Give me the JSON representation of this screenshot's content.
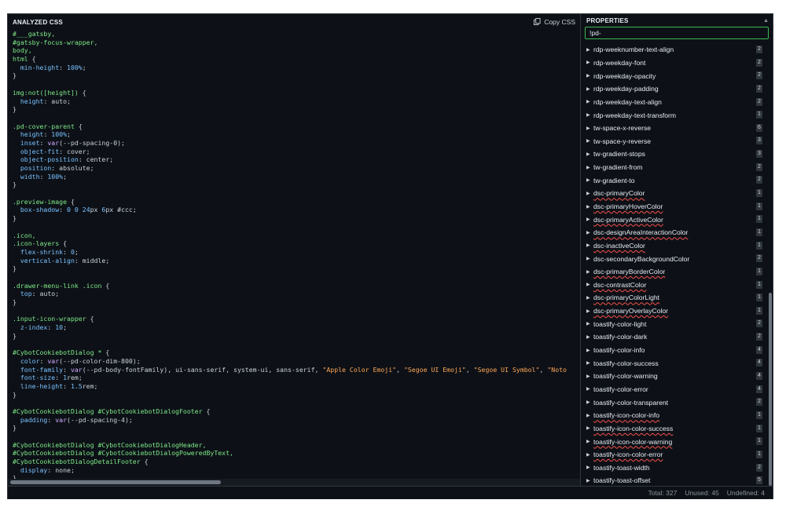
{
  "left_pane": {
    "title": "ANALYZED CSS",
    "copy_label": "Copy CSS",
    "code_lines": [
      [
        [
          "sel",
          "#___gatsby,"
        ]
      ],
      [
        [
          "sel",
          "#gatsby-focus-wrapper,"
        ]
      ],
      [
        [
          "sel",
          "body,"
        ]
      ],
      [
        [
          "sel",
          "html "
        ],
        [
          "punc",
          "{"
        ]
      ],
      [
        [
          "prop",
          "  min-height"
        ],
        [
          "punc",
          ": "
        ],
        [
          "num",
          "100%"
        ],
        [
          "punc",
          ";"
        ]
      ],
      [
        [
          "punc",
          "}"
        ]
      ],
      [],
      [
        [
          "sel",
          "img:not([height]) "
        ],
        [
          "punc",
          "{"
        ]
      ],
      [
        [
          "prop",
          "  height"
        ],
        [
          "punc",
          ": "
        ],
        [
          "val",
          "auto"
        ],
        [
          "punc",
          ";"
        ]
      ],
      [
        [
          "punc",
          "}"
        ]
      ],
      [],
      [
        [
          "sel",
          ".pd-cover-parent "
        ],
        [
          "punc",
          "{"
        ]
      ],
      [
        [
          "prop",
          "  height"
        ],
        [
          "punc",
          ": "
        ],
        [
          "num",
          "100%"
        ],
        [
          "punc",
          ";"
        ]
      ],
      [
        [
          "prop",
          "  inset"
        ],
        [
          "punc",
          ": "
        ],
        [
          "fn",
          "var"
        ],
        [
          "punc",
          "("
        ],
        [
          "val",
          "--pd-spacing-0"
        ],
        [
          "punc",
          ");"
        ]
      ],
      [
        [
          "prop",
          "  object-fit"
        ],
        [
          "punc",
          ": "
        ],
        [
          "val",
          "cover"
        ],
        [
          "punc",
          ";"
        ]
      ],
      [
        [
          "prop",
          "  object-position"
        ],
        [
          "punc",
          ": "
        ],
        [
          "val",
          "center"
        ],
        [
          "punc",
          ";"
        ]
      ],
      [
        [
          "prop",
          "  position"
        ],
        [
          "punc",
          ": "
        ],
        [
          "val",
          "absolute"
        ],
        [
          "punc",
          ";"
        ]
      ],
      [
        [
          "prop",
          "  width"
        ],
        [
          "punc",
          ": "
        ],
        [
          "num",
          "100%"
        ],
        [
          "punc",
          ";"
        ]
      ],
      [
        [
          "punc",
          "}"
        ]
      ],
      [],
      [
        [
          "sel",
          ".preview-image "
        ],
        [
          "punc",
          "{"
        ]
      ],
      [
        [
          "prop",
          "  box-shadow"
        ],
        [
          "punc",
          ": "
        ],
        [
          "num",
          "0"
        ],
        [
          "val",
          " "
        ],
        [
          "num",
          "0"
        ],
        [
          "val",
          " "
        ],
        [
          "num",
          "24"
        ],
        [
          "val",
          "px "
        ],
        [
          "num",
          "6"
        ],
        [
          "val",
          "px #ccc"
        ],
        [
          "punc",
          ";"
        ]
      ],
      [
        [
          "punc",
          "}"
        ]
      ],
      [],
      [
        [
          "sel",
          ".icon,"
        ]
      ],
      [
        [
          "sel",
          ".icon-layers "
        ],
        [
          "punc",
          "{"
        ]
      ],
      [
        [
          "prop",
          "  flex-shrink"
        ],
        [
          "punc",
          ": "
        ],
        [
          "num",
          "0"
        ],
        [
          "punc",
          ";"
        ]
      ],
      [
        [
          "prop",
          "  vertical-align"
        ],
        [
          "punc",
          ": "
        ],
        [
          "val",
          "middle"
        ],
        [
          "punc",
          ";"
        ]
      ],
      [
        [
          "punc",
          "}"
        ]
      ],
      [],
      [
        [
          "sel",
          ".drawer-menu-link .icon "
        ],
        [
          "punc",
          "{"
        ]
      ],
      [
        [
          "prop",
          "  top"
        ],
        [
          "punc",
          ": "
        ],
        [
          "val",
          "auto"
        ],
        [
          "punc",
          ";"
        ]
      ],
      [
        [
          "punc",
          "}"
        ]
      ],
      [],
      [
        [
          "sel",
          ".input-icon-wrapper "
        ],
        [
          "punc",
          "{"
        ]
      ],
      [
        [
          "prop",
          "  z-index"
        ],
        [
          "punc",
          ": "
        ],
        [
          "num",
          "10"
        ],
        [
          "punc",
          ";"
        ]
      ],
      [
        [
          "punc",
          "}"
        ]
      ],
      [],
      [
        [
          "sel",
          "#CybotCookiebotDialog * "
        ],
        [
          "punc",
          "{"
        ]
      ],
      [
        [
          "prop",
          "  color"
        ],
        [
          "punc",
          ": "
        ],
        [
          "fn",
          "var"
        ],
        [
          "punc",
          "("
        ],
        [
          "val",
          "--pd-color-dim-800"
        ],
        [
          "punc",
          ");"
        ]
      ],
      [
        [
          "prop",
          "  font-family"
        ],
        [
          "punc",
          ": "
        ],
        [
          "fn",
          "var"
        ],
        [
          "punc",
          "("
        ],
        [
          "val",
          "--pd-body-fontFamily"
        ],
        [
          "punc",
          "), "
        ],
        [
          "val",
          "ui-sans-serif, system-ui, sans-serif, "
        ],
        [
          "str",
          "\"Apple Color Emoji\""
        ],
        [
          "punc",
          ", "
        ],
        [
          "str",
          "\"Segoe UI Emoji\""
        ],
        [
          "punc",
          ", "
        ],
        [
          "str",
          "\"Segoe UI Symbol\""
        ],
        [
          "punc",
          ", "
        ],
        [
          "str",
          "\"Noto"
        ]
      ],
      [
        [
          "prop",
          "  font-size"
        ],
        [
          "punc",
          ": "
        ],
        [
          "num",
          "1"
        ],
        [
          "val",
          "rem"
        ],
        [
          "punc",
          ";"
        ]
      ],
      [
        [
          "prop",
          "  line-height"
        ],
        [
          "punc",
          ": "
        ],
        [
          "num",
          "1.5"
        ],
        [
          "val",
          "rem"
        ],
        [
          "punc",
          ";"
        ]
      ],
      [
        [
          "punc",
          "}"
        ]
      ],
      [],
      [
        [
          "sel",
          "#CybotCookiebotDialog #CybotCookiebotDialogFooter "
        ],
        [
          "punc",
          "{"
        ]
      ],
      [
        [
          "prop",
          "  padding"
        ],
        [
          "punc",
          ": "
        ],
        [
          "fn",
          "var"
        ],
        [
          "punc",
          "("
        ],
        [
          "val",
          "--pd-spacing-4"
        ],
        [
          "punc",
          ");"
        ]
      ],
      [
        [
          "punc",
          "}"
        ]
      ],
      [],
      [
        [
          "sel",
          "#CybotCookiebotDialog #CybotCookiebotDialogHeader,"
        ]
      ],
      [
        [
          "sel",
          "#CybotCookiebotDialog #CybotCookiebotDialogPoweredByText,"
        ]
      ],
      [
        [
          "sel",
          "#CybotCookiebotDialogDetailFooter "
        ],
        [
          "punc",
          "{"
        ]
      ],
      [
        [
          "prop",
          "  display"
        ],
        [
          "punc",
          ": "
        ],
        [
          "val",
          "none"
        ],
        [
          "punc",
          ";"
        ]
      ],
      [
        [
          "punc",
          "}"
        ]
      ]
    ]
  },
  "right_pane": {
    "title": "PROPERTIES",
    "sort_icon": "sort-arrows-icon",
    "filter_value": "!pd-",
    "properties": [
      {
        "name": "rdp-weeknumber-text-align",
        "count": "2",
        "undefined": false
      },
      {
        "name": "rdp-weekday-font",
        "count": "2",
        "undefined": false
      },
      {
        "name": "rdp-weekday-opacity",
        "count": "2",
        "undefined": false
      },
      {
        "name": "rdp-weekday-padding",
        "count": "2",
        "undefined": false
      },
      {
        "name": "rdp-weekday-text-align",
        "count": "2",
        "undefined": false
      },
      {
        "name": "rdp-weekday-text-transform",
        "count": "1",
        "undefined": false
      },
      {
        "name": "tw-space-x-reverse",
        "count": "6",
        "undefined": false
      },
      {
        "name": "tw-space-y-reverse",
        "count": "3",
        "undefined": false
      },
      {
        "name": "tw-gradient-stops",
        "count": "3",
        "undefined": false
      },
      {
        "name": "tw-gradient-from",
        "count": "2",
        "undefined": false
      },
      {
        "name": "tw-gradient-to",
        "count": "2",
        "undefined": false
      },
      {
        "name": "dsc-primaryColor",
        "count": "1",
        "undefined": true
      },
      {
        "name": "dsc-primaryHoverColor",
        "count": "1",
        "undefined": true
      },
      {
        "name": "dsc-primaryActiveColor",
        "count": "1",
        "undefined": true
      },
      {
        "name": "dsc-designAreaInteractionColor",
        "count": "1",
        "undefined": true
      },
      {
        "name": "dsc-inactiveColor",
        "count": "1",
        "undefined": true
      },
      {
        "name": "dsc-secondaryBackgroundColor",
        "count": "2",
        "undefined": false
      },
      {
        "name": "dsc-primaryBorderColor",
        "count": "1",
        "undefined": true
      },
      {
        "name": "dsc-contrastColor",
        "count": "1",
        "undefined": true
      },
      {
        "name": "dsc-primaryColorLight",
        "count": "1",
        "undefined": true
      },
      {
        "name": "dsc-primaryOverlayColor",
        "count": "1",
        "undefined": true
      },
      {
        "name": "toastify-color-light",
        "count": "2",
        "undefined": false
      },
      {
        "name": "toastify-color-dark",
        "count": "2",
        "undefined": false
      },
      {
        "name": "toastify-color-info",
        "count": "4",
        "undefined": false
      },
      {
        "name": "toastify-color-success",
        "count": "4",
        "undefined": false
      },
      {
        "name": "toastify-color-warning",
        "count": "4",
        "undefined": false
      },
      {
        "name": "toastify-color-error",
        "count": "4",
        "undefined": false
      },
      {
        "name": "toastify-color-transparent",
        "count": "2",
        "undefined": false
      },
      {
        "name": "toastify-icon-color-info",
        "count": "1",
        "undefined": true
      },
      {
        "name": "toastify-icon-color-success",
        "count": "1",
        "undefined": true
      },
      {
        "name": "toastify-icon-color-warning",
        "count": "1",
        "undefined": true
      },
      {
        "name": "toastify-icon-color-error",
        "count": "1",
        "undefined": true
      },
      {
        "name": "toastify-toast-width",
        "count": "2",
        "undefined": false
      },
      {
        "name": "toastify-toast-offset",
        "count": "5",
        "undefined": false
      }
    ]
  },
  "footer": {
    "total": "Total: 327",
    "unused": "Unused: 45",
    "undefined": "Undefined: 4"
  },
  "colors": {
    "background": "#0d1117",
    "border": "#30363d",
    "selector": "#7ee787",
    "property": "#79c0ff",
    "string": "#ffa657",
    "function": "#d2a8ff",
    "filter_focus": "#3fb950",
    "undefined_underline": "#f85149"
  }
}
